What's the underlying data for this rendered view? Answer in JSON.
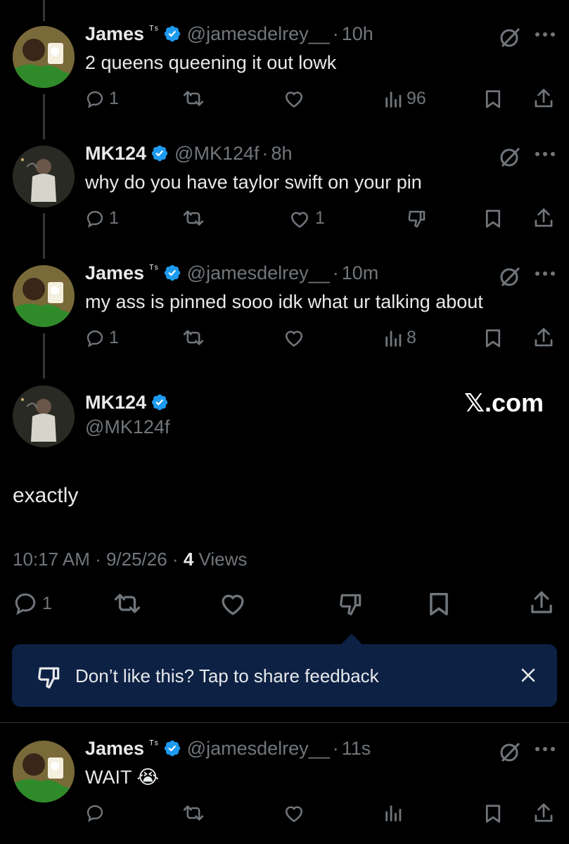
{
  "tweets": [
    {
      "name": "James",
      "badge": "ᵀˢ",
      "handle": "@jamesdelrey__",
      "time": "10h",
      "text": "2 queens queening it out lowk",
      "replies": "1",
      "reposts": "",
      "likes": "",
      "views": "96"
    },
    {
      "name": "MK124",
      "badge": "",
      "handle": "@MK124f",
      "time": "8h",
      "text": "why do you have taylor swift on your pin",
      "replies": "1",
      "reposts": "",
      "likes": "1"
    },
    {
      "name": "James",
      "badge": "ᵀˢ",
      "handle": "@jamesdelrey__",
      "time": "10m",
      "text": "my ass is pinned sooo idk what ur talking about",
      "replies": "1",
      "reposts": "",
      "likes": "",
      "views": "8"
    }
  ],
  "focused": {
    "name": "MK124",
    "handle": "@MK124f",
    "watermark": "𝕏.com",
    "text": "exactly",
    "timestamp": "10:17 AM · 9/25/26 · ",
    "views_count": "4",
    "views_label": " Views",
    "replies": "1"
  },
  "feedback": {
    "text": "Don’t like this? Tap to share feedback"
  },
  "reply": {
    "name": "James",
    "badge": "ᵀˢ",
    "handle": "@jamesdelrey__",
    "time": "11s",
    "text": "WAIT 😭"
  },
  "separator": "·",
  "icons": [
    "reply-icon",
    "repost-icon",
    "like-icon",
    "views-icon",
    "dislike-icon",
    "bookmark-icon",
    "share-icon",
    "grok-icon",
    "more-icon",
    "verified-icon",
    "close-icon"
  ],
  "colors": {
    "verified": "#1d9bf0",
    "muted": "#71767b",
    "feedback_bg": "#0d2145"
  }
}
